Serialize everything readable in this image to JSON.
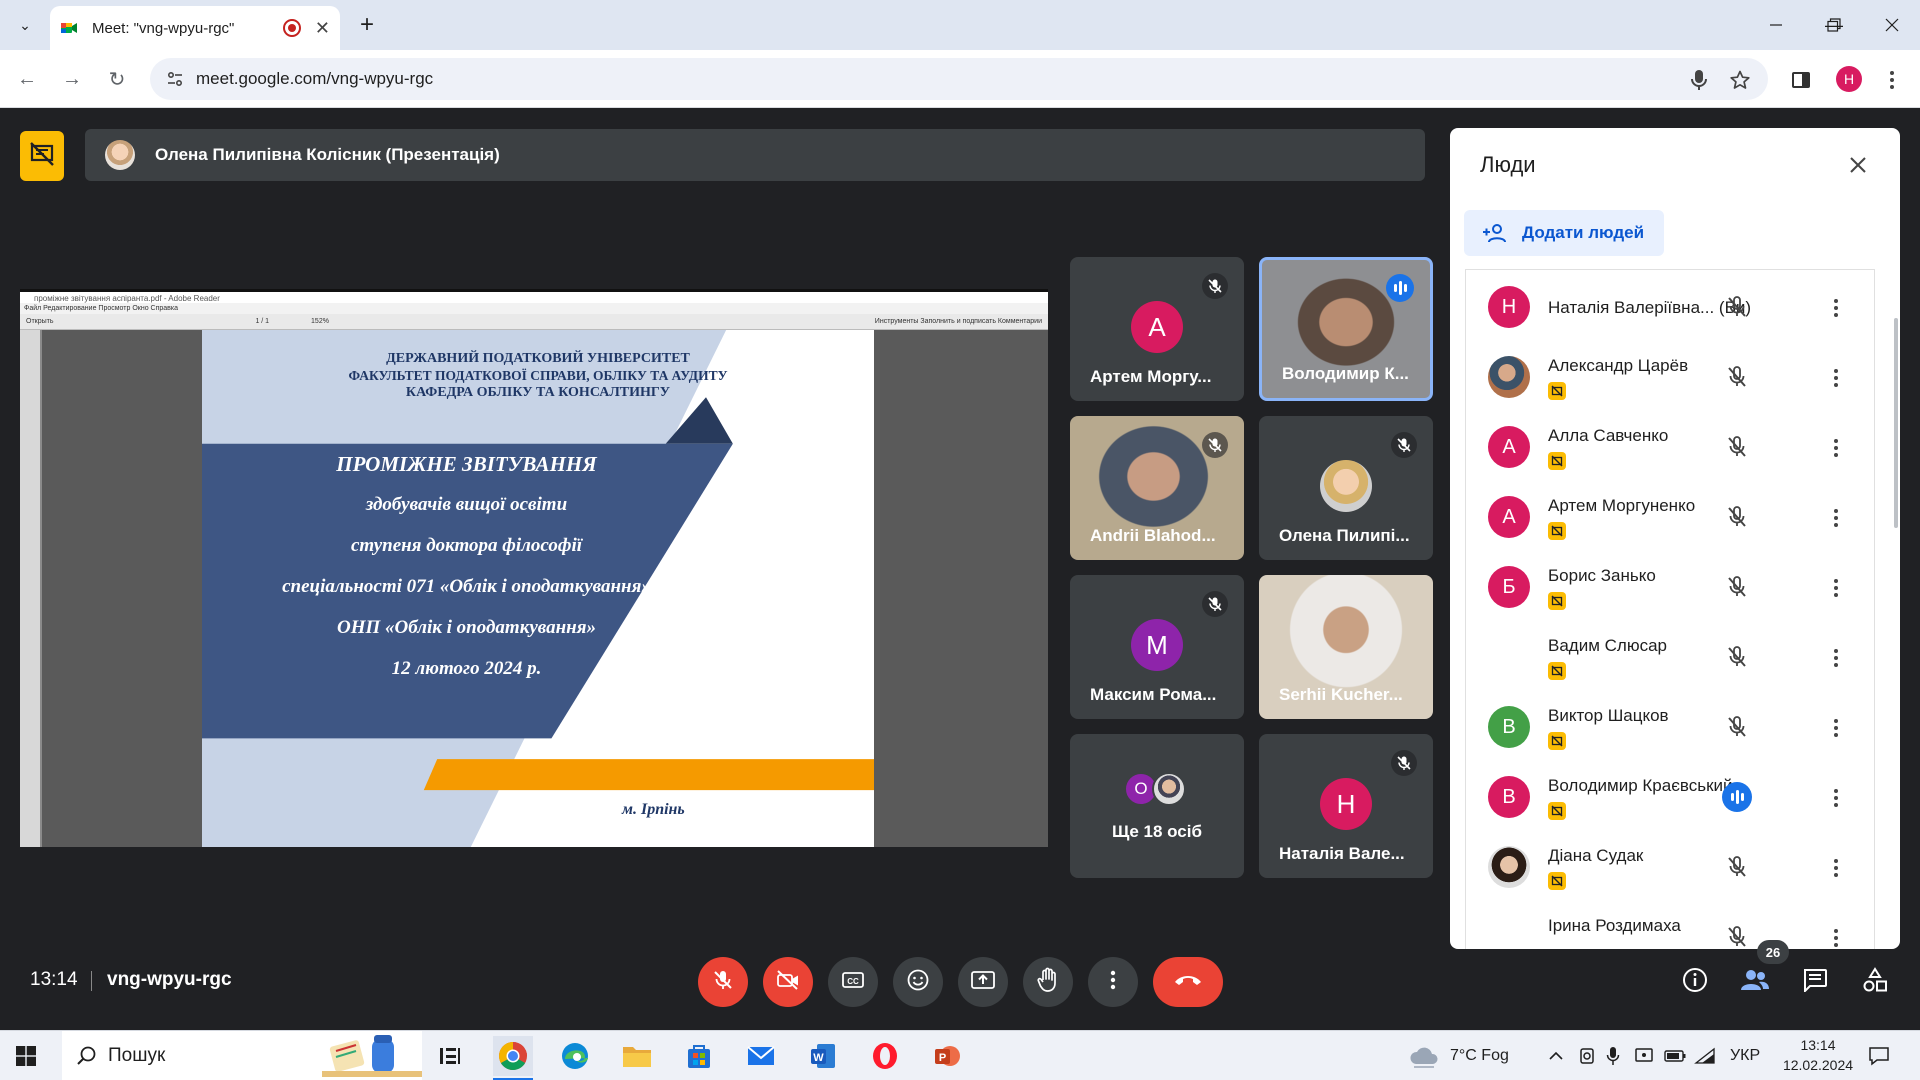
{
  "browser": {
    "tab_title": "Meet: \"vng-wpyu-rgc\"",
    "new_tab": "+",
    "url": "meet.google.com/vng-wpyu-rgc",
    "profile_initial": "H"
  },
  "presenter_bar": {
    "text": "Олена Пилипівна Колісник (Презентація)"
  },
  "reader": {
    "titlebar": "проміжне звітування аспіранта.pdf - Adobe Reader",
    "menu": "Файл   Редактирование   Просмотр   Окно   Справка",
    "toolbar_left": "Открыть",
    "page_box": "1   / 1",
    "zoom": "152%",
    "toolbar_right": "Инструменты     Заполнить и подписать     Комментарии"
  },
  "slide": {
    "org_line1": "ДЕРЖАВНИЙ ПОДАТКОВИЙ УНІВЕРСИТЕТ",
    "org_line2": "ФАКУЛЬТЕТ ПОДАТКОВОЇ СПРАВИ, ОБЛІКУ ТА АУДИТУ",
    "org_line3": "КАФЕДРА ОБЛІКУ ТА КОНСАЛТИНГУ",
    "title1": "ПРОМІЖНЕ ЗВІТУВАННЯ",
    "title2": "здобувачів вищої освіти",
    "title3": "ступеня доктора філософії",
    "title4": "спеціальності 071 «Облік і оподаткування»",
    "title5": "ОНП «Облік і оподаткування»",
    "title6": "12 лютого 2024 р.",
    "city": "м. Ірпінь"
  },
  "tiles": [
    {
      "name": "Артем Моргу...",
      "initial": "A",
      "color": "#d81b60"
    },
    {
      "name": "Володимир К..."
    },
    {
      "name": "Andrii Blahod..."
    },
    {
      "name": "Олена Пилипі..."
    },
    {
      "name": "Максим Рома...",
      "initial": "M",
      "color": "#8e24aa"
    },
    {
      "name": "Serhii Kucher..."
    },
    {
      "name": "Ще 18 осіб",
      "initial": "O",
      "color": "#8e24aa"
    },
    {
      "name": "Наталія Вале...",
      "initial": "H",
      "color": "#d81b60"
    }
  ],
  "people_panel": {
    "title": "Люди",
    "add_people": "Додати людей",
    "people": [
      {
        "name": "Наталія Валеріївна... (Ви)",
        "initial": "H",
        "color": "#d81b60"
      },
      {
        "name": "Александр Царёв",
        "initial": "",
        "color": "#5d4037"
      },
      {
        "name": "Алла Савченко",
        "initial": "А",
        "color": "#d81b60"
      },
      {
        "name": "Артем Моргуненко",
        "initial": "А",
        "color": "#d81b60"
      },
      {
        "name": "Борис Занько",
        "initial": "Б",
        "color": "#d81b60"
      },
      {
        "name": "Вадим Слюсар",
        "initial": "",
        "color": "#ffffff"
      },
      {
        "name": "Виктор Шацков",
        "initial": "В",
        "color": "#43a047"
      },
      {
        "name": "Володимир Краєвський",
        "initial": "В",
        "color": "#d81b60"
      },
      {
        "name": "Діана Судак",
        "initial": "",
        "color": "#6d4c41"
      },
      {
        "name": "Ірина Роздимаха",
        "initial": "",
        "color": "#ffffff"
      }
    ]
  },
  "bottom_bar": {
    "time": "13:14",
    "meeting_code": "vng-wpyu-rgc",
    "participant_count": "26"
  },
  "taskbar": {
    "search_label": "Пошук",
    "weather": "7°C  Fog",
    "language": "УКР",
    "clock_time": "13:14",
    "clock_date": "12.02.2024"
  }
}
